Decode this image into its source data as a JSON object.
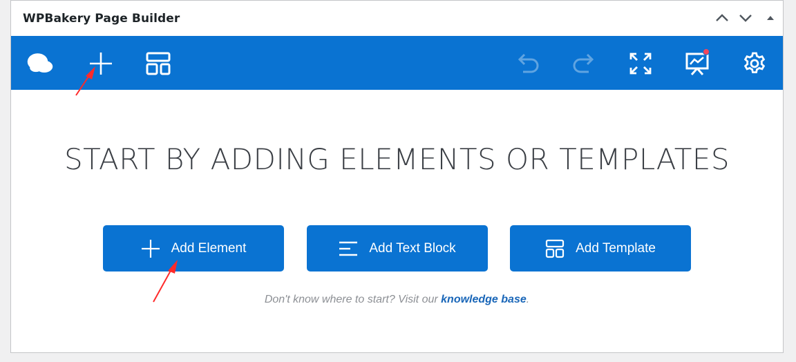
{
  "panel": {
    "title": "WPBakery Page Builder"
  },
  "header_controls": [
    "chevron-up-icon",
    "chevron-down-icon",
    "triangle-up-icon"
  ],
  "toolbar": {
    "left_icons": [
      "wpbakery-logo-icon",
      "plus-icon",
      "template-icon"
    ],
    "right_icons": [
      "undo-icon",
      "redo-icon",
      "fullscreen-icon",
      "presentation-icon",
      "gear-icon"
    ],
    "bg_color": "#0a73d2",
    "notification_color": "#f2475c"
  },
  "main": {
    "headline": "START BY ADDING ELEMENTS OR TEMPLATES",
    "buttons": [
      {
        "label": "Add Element",
        "icon": "plus-icon"
      },
      {
        "label": "Add Text Block",
        "icon": "text-lines-icon"
      },
      {
        "label": "Add Template",
        "icon": "template-icon"
      }
    ],
    "help_prefix": "Don't know where to start? Visit our ",
    "help_link": "knowledge base",
    "help_suffix": "."
  },
  "annotation_color": "#ff2a2a"
}
